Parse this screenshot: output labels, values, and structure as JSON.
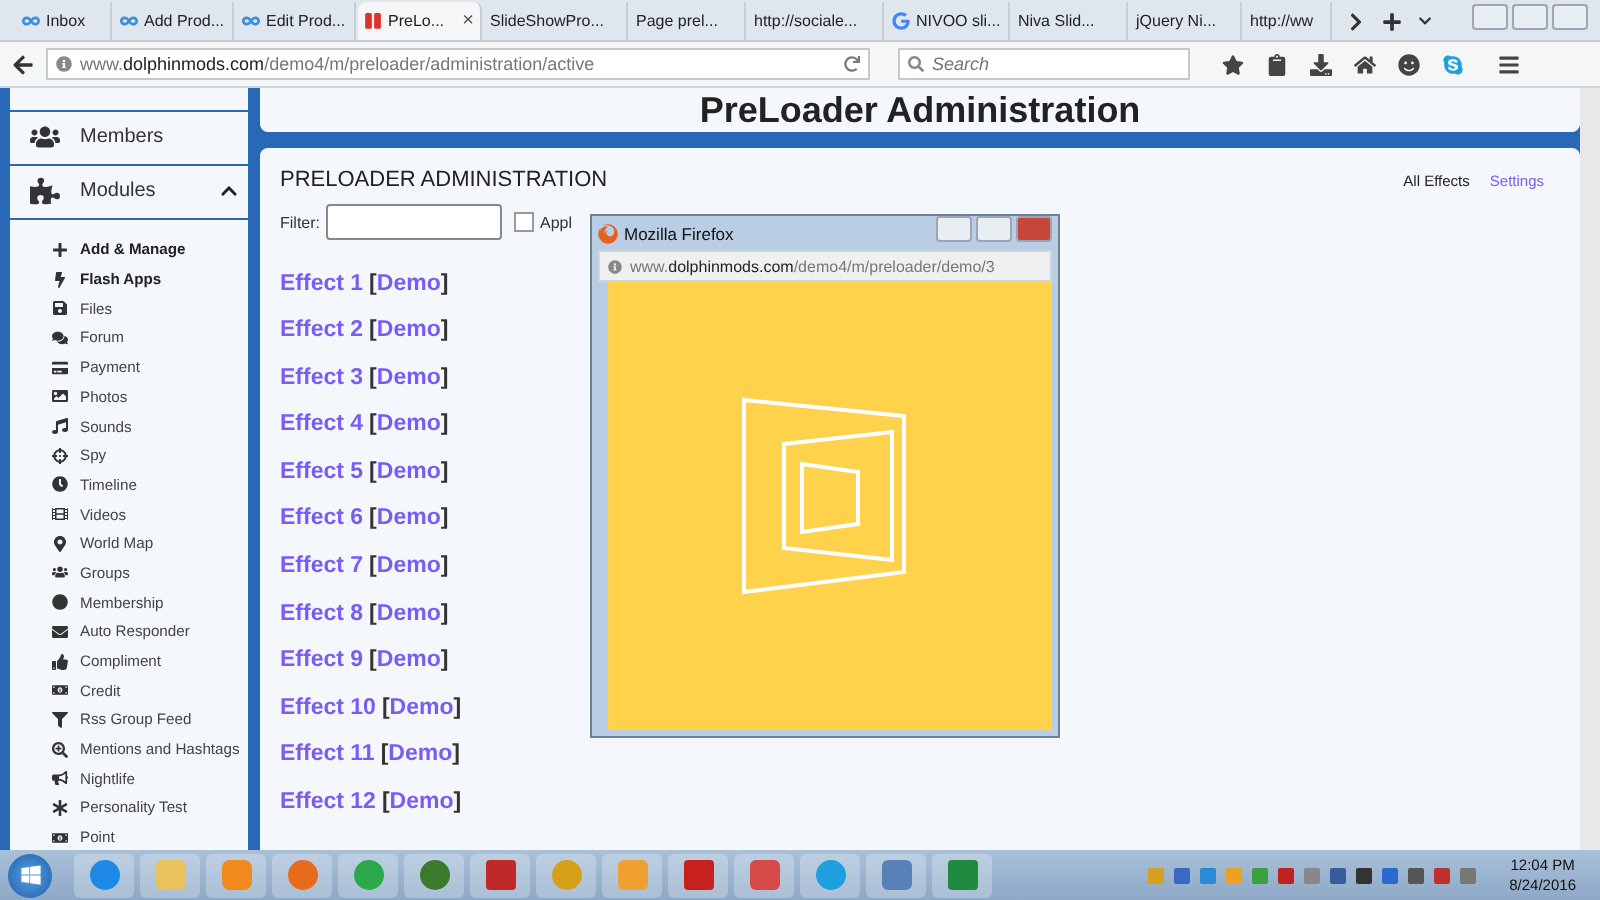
{
  "browser_tabs": [
    {
      "label": "Inbox",
      "selected": false
    },
    {
      "label": "Add Prod...",
      "selected": false
    },
    {
      "label": "Edit Prod...",
      "selected": false
    },
    {
      "label": "PreLo...",
      "selected": true,
      "close": "×"
    },
    {
      "label": "SlideShowPro...",
      "selected": false
    },
    {
      "label": "Page prel...",
      "selected": false
    },
    {
      "label": "http://sociale...",
      "selected": false
    },
    {
      "label": "NIVOO sli...",
      "selected": false
    },
    {
      "label": "Niva Slid...",
      "selected": false
    },
    {
      "label": "jQuery Ni...",
      "selected": false
    },
    {
      "label": "http://ww",
      "selected": false
    }
  ],
  "address_bar": {
    "prefix": "www.",
    "domain": "dolphinmods.com",
    "path": "/demo4/m/preloader/administration/active"
  },
  "search": {
    "placeholder": "Search"
  },
  "sidebar": {
    "sections": [
      {
        "label": "Members",
        "expanded": false
      },
      {
        "label": "Modules",
        "expanded": true
      }
    ],
    "items": [
      {
        "label": "Add & Manage",
        "kind": "action"
      },
      {
        "label": "Flash Apps",
        "kind": "action"
      },
      {
        "label": "Files",
        "kind": "module"
      },
      {
        "label": "Forum",
        "kind": "module"
      },
      {
        "label": "Payment",
        "kind": "module"
      },
      {
        "label": "Photos",
        "kind": "module"
      },
      {
        "label": "Sounds",
        "kind": "module"
      },
      {
        "label": "Spy",
        "kind": "module"
      },
      {
        "label": "Timeline",
        "kind": "module"
      },
      {
        "label": "Videos",
        "kind": "module"
      },
      {
        "label": "World Map",
        "kind": "module"
      },
      {
        "label": "Groups",
        "kind": "module"
      },
      {
        "label": "Membership",
        "kind": "module"
      },
      {
        "label": "Auto Responder",
        "kind": "module"
      },
      {
        "label": "Compliment",
        "kind": "module"
      },
      {
        "label": "Credit",
        "kind": "module"
      },
      {
        "label": "Rss Group Feed",
        "kind": "module"
      },
      {
        "label": "Mentions and Hashtags",
        "kind": "module"
      },
      {
        "label": "Nightlife",
        "kind": "module"
      },
      {
        "label": "Personality Test",
        "kind": "module"
      },
      {
        "label": "Point",
        "kind": "module"
      }
    ]
  },
  "page_title": "PreLoader Administration",
  "panel": {
    "title": "PRELOADER ADMINISTRATION",
    "links": [
      {
        "label": "All Effects",
        "selected": true
      },
      {
        "label": "Settings",
        "selected": false
      }
    ],
    "filter_label": "Filter:",
    "apply": {
      "label": "Appl",
      "checked": false
    }
  },
  "brackets": [
    "[",
    "]"
  ],
  "effects": [
    {
      "label": "Effect 1",
      "link": "Demo"
    },
    {
      "label": "Effect 2",
      "link": "Demo"
    },
    {
      "label": "Effect 3",
      "link": "Demo"
    },
    {
      "label": "Effect 4",
      "link": "Demo"
    },
    {
      "label": "Effect 5",
      "link": "Demo"
    },
    {
      "label": "Effect 6",
      "link": "Demo"
    },
    {
      "label": "Effect 7",
      "link": "Demo"
    },
    {
      "label": "Effect 8",
      "link": "Demo"
    },
    {
      "label": "Effect 9",
      "link": "Demo"
    },
    {
      "label": "Effect 10",
      "link": "Demo"
    },
    {
      "label": "Effect 11",
      "link": "Demo"
    },
    {
      "label": "Effect 12",
      "link": "Demo"
    }
  ],
  "popup": {
    "title": "Mozilla Firefox",
    "url": {
      "prefix": "www.",
      "domain": "dolphinmods.com",
      "path": "/demo4/m/preloader/demo/3"
    }
  },
  "clock": {
    "time": "12:04 PM",
    "date": "8/24/2016"
  }
}
